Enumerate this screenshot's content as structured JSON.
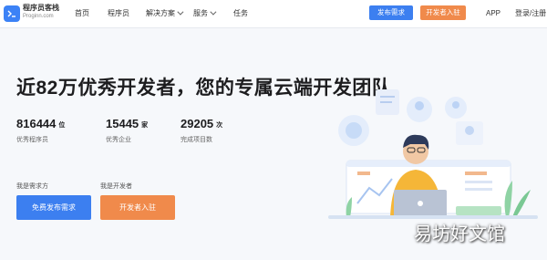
{
  "header": {
    "logo_title": "程序员客栈",
    "logo_sub": "Proginn.com",
    "nav": [
      {
        "label": "首页"
      },
      {
        "label": "程序员"
      },
      {
        "label": "解决方案"
      },
      {
        "label": "服务"
      },
      {
        "label": "任务"
      }
    ],
    "publish_btn": "发布需求",
    "dev_join_btn": "开发者入驻",
    "app_link": "APP",
    "login_link": "登录/注册"
  },
  "hero": {
    "headline": "近82万优秀开发者，您的专属云端开发团队",
    "stats": [
      {
        "value": "816444",
        "unit": "位",
        "label": "优秀程序员"
      },
      {
        "value": "15445",
        "unit": "家",
        "label": "优秀企业"
      },
      {
        "value": "29205",
        "unit": "次",
        "label": "完成项目数"
      }
    ],
    "cta": [
      {
        "label_above": "我是需求方",
        "button": "免费发布需求",
        "color": "#3c7ff0"
      },
      {
        "label_above": "我是开发者",
        "button": "开发者入驻",
        "color": "#f08a4b"
      }
    ]
  },
  "watermark": "易坊好文馆",
  "colors": {
    "primary": "#3c7ff0",
    "accent": "#f08a4b",
    "background": "#f6f8fb"
  }
}
